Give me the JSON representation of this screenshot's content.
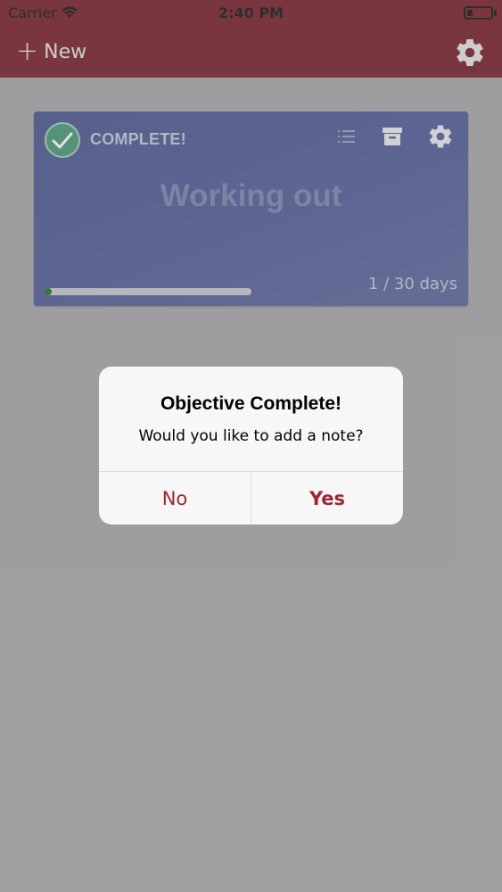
{
  "status_bar": {
    "carrier": "Carrier",
    "time": "2:40 PM"
  },
  "nav": {
    "new_label": "New",
    "plus_icon": "+",
    "settings_icon": "gear-icon"
  },
  "card": {
    "status_label": "COMPLETE!",
    "title": "Working out",
    "progress_text": "1 / 30 days",
    "progress_fraction": 0.0333,
    "icons": [
      "check-icon",
      "list-icon",
      "archive-icon",
      "gear-icon"
    ],
    "colors": {
      "card": "#56619a",
      "check": "#4e9a7c",
      "progress": "#1f7a2e"
    }
  },
  "dialog": {
    "title": "Objective Complete!",
    "message": "Would you like to add a note?",
    "no_label": "No",
    "yes_label": "Yes"
  },
  "colors": {
    "brand": "#7b2430",
    "accent": "#9a2735"
  }
}
